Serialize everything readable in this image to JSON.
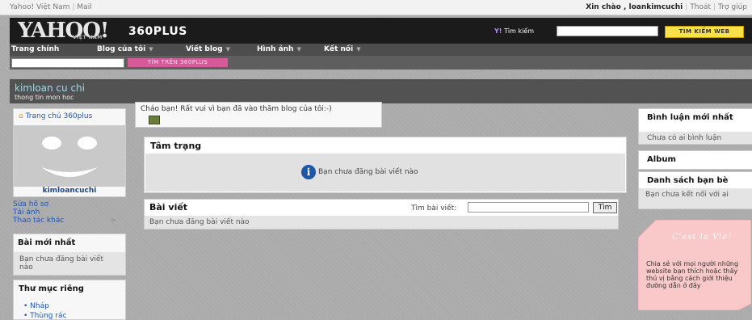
{
  "topbar": {
    "left": [
      "Yahoo! Việt Nam",
      "Mail"
    ],
    "greeting": "Xin chào , loankimcuchi",
    "logout": "Thoát",
    "help": "Trợ giúp"
  },
  "header": {
    "logo": "YAHOO!",
    "logo_sub": "VIỆT NAM",
    "brand": "360PLUS",
    "search_label_prefix": "Y!",
    "search_label": "Tìm kiếm",
    "search_value": "",
    "search_button": "TÌM KIẾM WEB"
  },
  "nav": [
    {
      "label": "Trang chính",
      "has_menu": false
    },
    {
      "label": "Blog của tôi",
      "has_menu": true
    },
    {
      "label": "Viết blog",
      "has_menu": true
    },
    {
      "label": "Hình ảnh",
      "has_menu": true
    },
    {
      "label": "Kết nối",
      "has_menu": true
    }
  ],
  "search360": {
    "value": "",
    "button": "TÌM TRÊN 360PLUS"
  },
  "blog": {
    "title": "kimloan cu chi",
    "subtitle": "thong tin mon hoc"
  },
  "profile": {
    "home_link": "Trang chủ 360plus",
    "name": "kimloancuchi",
    "links": [
      "Sửa hồ sơ",
      "Tải ảnh",
      "Thao tác khác"
    ]
  },
  "newest_posts": {
    "title": "Bài mới nhất",
    "empty": "Bạn chưa đăng bài viết nào"
  },
  "folders": {
    "title": "Thư mục riêng",
    "items": [
      "Nháp",
      "Thùng rác"
    ]
  },
  "greeting_box": {
    "text": "Cháo bạn! Rất vui vì bạn đã vào thăm blog của tôi:-)"
  },
  "mood": {
    "title": "Tâm trạng",
    "empty": "Bạn chưa đăng bài viết nào"
  },
  "posts": {
    "title": "Bài viết",
    "search_label": "Tìm bài viết:",
    "search_value": "",
    "search_button": "Tìm",
    "empty": "Bạn chưa đăng bài viết nào"
  },
  "comments": {
    "title": "Bình luận mới nhất",
    "empty": "Chưa có ai bình luận"
  },
  "album": {
    "title": "Album"
  },
  "friends": {
    "title": "Danh sách bạn bè",
    "empty": "Bạn chưa kết nối với ai"
  },
  "share": {
    "script": "C'est la Vie!",
    "text": "Chia sẻ với mọi người những website bạn thích hoặc thấy thú vị bằng cách giới thiệu đường dẫn ở đây"
  },
  "colors": {
    "header": "#1b1b1b",
    "nav": "#4d4d4d",
    "search_button": "#f7e24a",
    "search360_button": "#d65a9a",
    "link": "#2255aa",
    "blog_title": "#99ddee",
    "share_note": "#f9c8c8"
  }
}
